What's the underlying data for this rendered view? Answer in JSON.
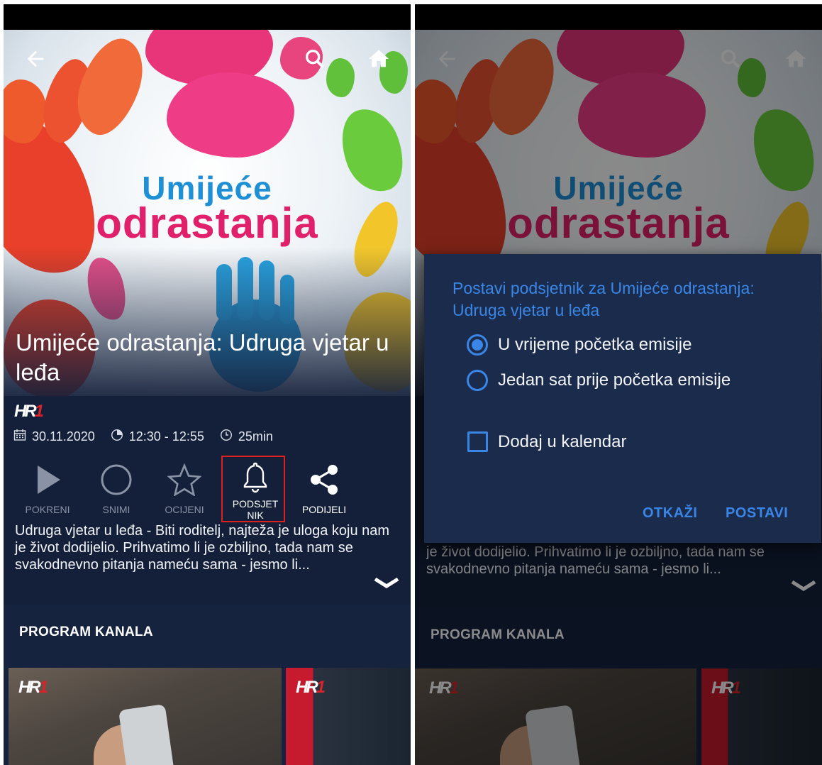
{
  "colors": {
    "accent": "#3a86e6",
    "background": "#14203a",
    "highlight": "#e0201c",
    "title_blue": "#1f8fd6",
    "title_pink": "#e0206a"
  },
  "hero": {
    "title_line1": "Umijeće",
    "title_line2": "odrastanja"
  },
  "header": {
    "back_icon": "arrow-left-icon",
    "search_icon": "search-icon",
    "home_icon": "home-icon"
  },
  "show": {
    "title": "Umijeće odrastanja: Udruga vjetar u leđa",
    "channel_logo": {
      "main": "HR",
      "accent": "1"
    },
    "date": "30.11.2020",
    "time": "12:30 - 12:55",
    "duration": "25min",
    "description": "Udruga vjetar u leđa - Biti roditelj, najteža je uloga koju nam je život dodijelio. Prihvatimo li je ozbiljno, tada nam se svakodnevno pitanja nameću sama - jesmo li..."
  },
  "actions": {
    "play": "POKRENI",
    "record": "SNIMI",
    "rate": "OCIJENI",
    "reminder_line1": "PODSJET",
    "reminder_line2": "NIK",
    "share": "PODIJELI"
  },
  "section": {
    "title": "PROGRAM KANALA"
  },
  "dialog": {
    "title": "Postavi podsjetnik za Umijeće odrastanja: Udruga vjetar u leđa",
    "option1": "U vrijeme početka emisije",
    "option1_selected": true,
    "option2": "Jedan sat prije početka emisije",
    "option2_selected": false,
    "calendar_label": "Dodaj u kalendar",
    "calendar_checked": false,
    "cancel": "OTKAŽI",
    "confirm": "POSTAVI"
  }
}
